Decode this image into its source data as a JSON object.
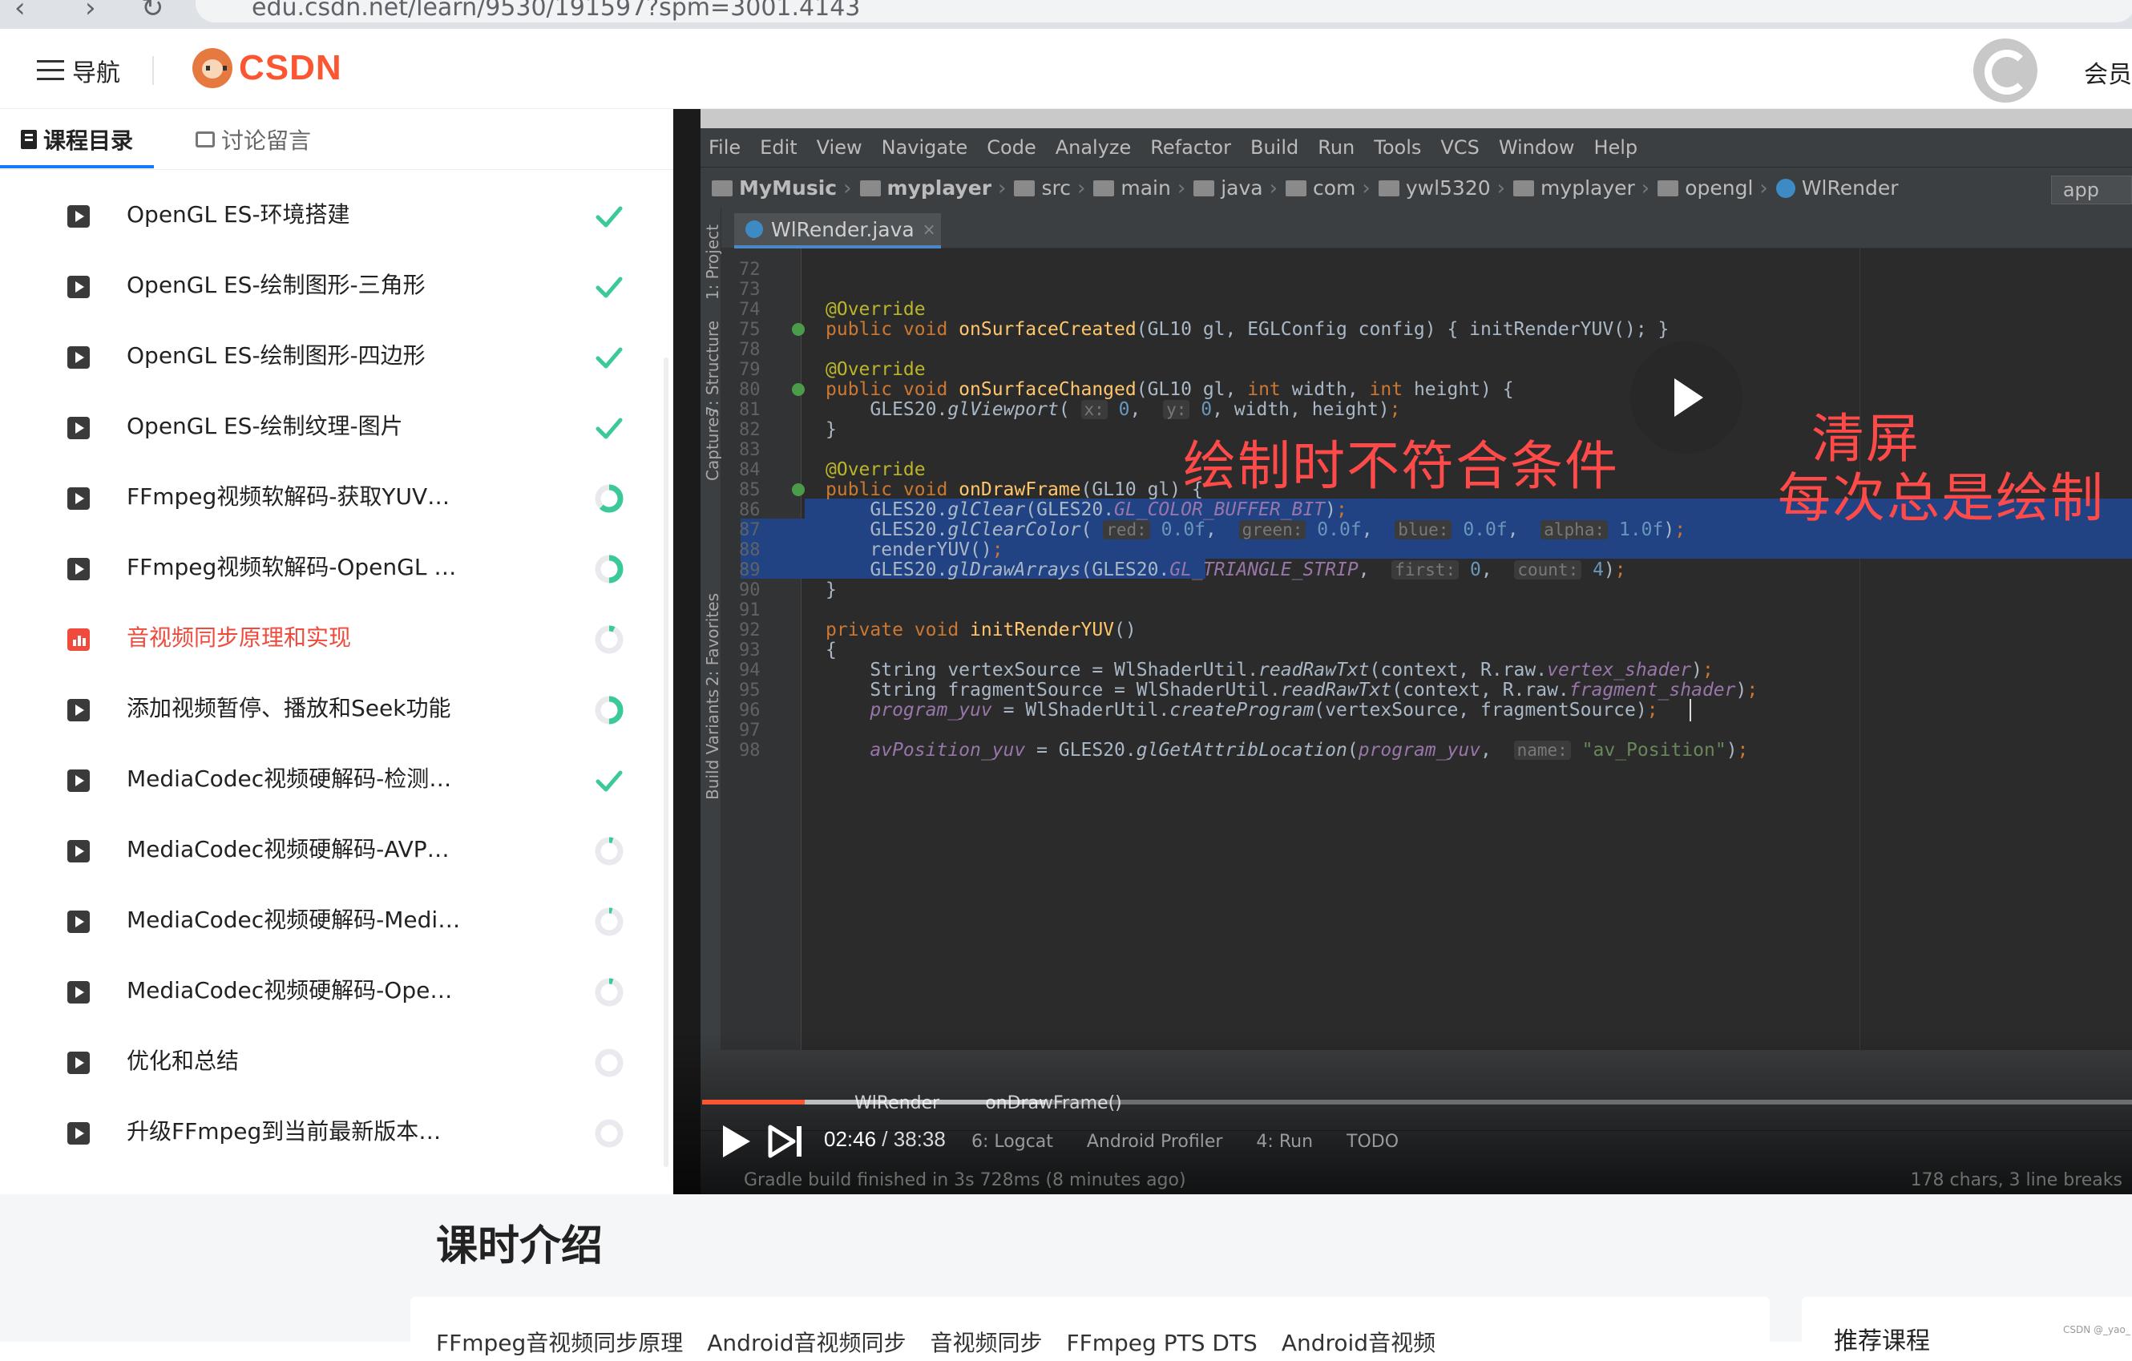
{
  "browser": {
    "url_fragment": "edu.csdn.net/learn/9530/191597?spm=3001.4143"
  },
  "header": {
    "nav_label": "导航",
    "logo_text": "CSDN",
    "vip_label": "会员"
  },
  "panel": {
    "tabs": [
      {
        "label": "课程目录"
      },
      {
        "label": "讨论留言"
      }
    ],
    "lessons": [
      {
        "title": "OpenGL ES-环境搭建",
        "progress": 1.0,
        "active": false
      },
      {
        "title": "OpenGL ES-绘制图形-三角形",
        "progress": 1.0,
        "active": false
      },
      {
        "title": "OpenGL ES-绘制图形-四边形",
        "progress": 1.0,
        "active": false
      },
      {
        "title": "OpenGL ES-绘制纹理-图片",
        "progress": 1.0,
        "active": false
      },
      {
        "title": "FFmpeg视频软解码-获取YUV…",
        "progress": 0.62,
        "active": false
      },
      {
        "title": "FFmpeg视频软解码-OpenGL …",
        "progress": 0.5,
        "active": false
      },
      {
        "title": "音视频同步原理和实现",
        "progress": 0.07,
        "active": true
      },
      {
        "title": "添加视频暂停、播放和Seek功能",
        "progress": 0.5,
        "active": false
      },
      {
        "title": "MediaCodec视频硬解码-检测…",
        "progress": 1.0,
        "active": false
      },
      {
        "title": "MediaCodec视频硬解码-AVP…",
        "progress": 0.05,
        "active": false
      },
      {
        "title": "MediaCodec视频硬解码-Medi…",
        "progress": 0.04,
        "active": false
      },
      {
        "title": "MediaCodec视频硬解码-Ope…",
        "progress": 0.05,
        "active": false
      },
      {
        "title": "优化和总结",
        "progress": 0.0,
        "active": false
      },
      {
        "title": "升级FFmpeg到当前最新版本…",
        "progress": 0.0,
        "active": false
      }
    ],
    "colors": {
      "done": "#3cc99a",
      "ring": "#e8eaed",
      "active": "#f04a3d"
    }
  },
  "ide": {
    "menu": [
      "File",
      "Edit",
      "View",
      "Navigate",
      "Code",
      "Analyze",
      "Refactor",
      "Build",
      "Run",
      "Tools",
      "VCS",
      "Window",
      "Help"
    ],
    "breadcrumbs": [
      "MyMusic",
      "myplayer",
      "src",
      "main",
      "java",
      "com",
      "ywl5320",
      "myplayer",
      "opengl",
      "WlRender"
    ],
    "run_config": "app",
    "tab": "WlRender.java",
    "tool_windows": [
      "1: Project",
      "7: Structure",
      "Captures",
      "2: Favorites",
      "Build Variants"
    ],
    "bottom_tools": [
      "6: Logcat",
      "Android Profiler",
      "4: Run",
      "TODO"
    ],
    "structure_path": [
      "WlRender",
      "onDrawFrame()"
    ],
    "gradle_status": "Gradle build finished in 3s 728ms (8 minutes ago)",
    "selection_status": "178 chars, 3 line breaks",
    "line_numbers": [
      "72",
      "73",
      "74",
      "75",
      "78",
      "79",
      "80",
      "81",
      "82",
      "83",
      "84",
      "85",
      "86",
      "87",
      "88",
      "89",
      "90",
      "91",
      "92",
      "93",
      "94",
      "95",
      "96",
      "97",
      "98"
    ]
  },
  "overlays": {
    "clear_screen": "清屏",
    "condition_note": "绘制时不符合条件",
    "always_draw": "每次总是绘制"
  },
  "player": {
    "current_time": "02:46",
    "duration": "38:38",
    "played_fraction": 0.072,
    "buffered_fraction": 0.24
  },
  "lower": {
    "intro_heading": "课时介绍",
    "tags": [
      "FFmpeg音视频同步原理",
      "Android音视频同步",
      "音视频同步",
      "FFmpeg PTS DTS",
      "Android音视频"
    ],
    "recommend_heading": "推荐课程",
    "watermark": "CSDN @_yao_"
  }
}
